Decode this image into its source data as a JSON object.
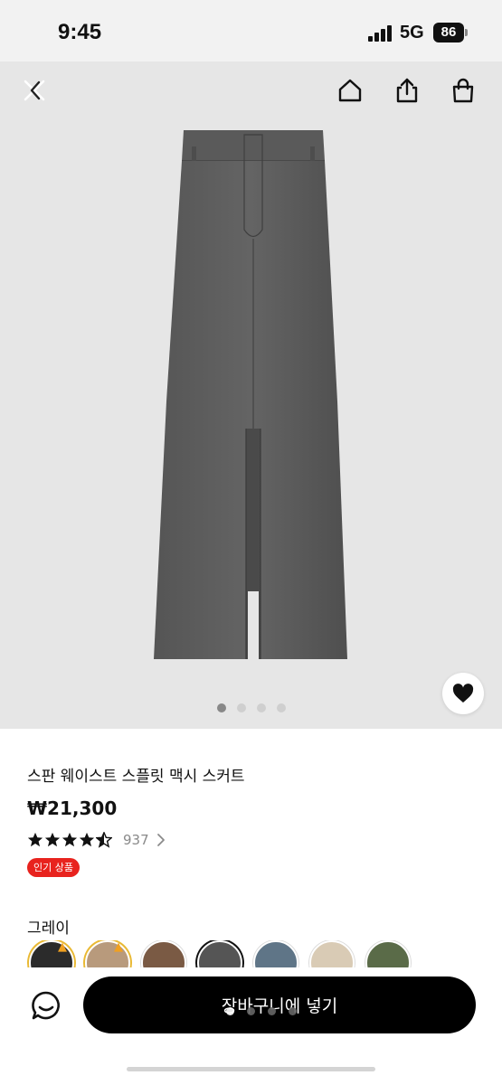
{
  "status_bar": {
    "time": "9:45",
    "network": "5G",
    "battery": "86"
  },
  "header": {
    "close_icon": "close-icon",
    "home_icon": "home-icon",
    "share_icon": "share-icon",
    "cart_icon": "shopping-bag-icon"
  },
  "gallery": {
    "image_count": 4,
    "active_index": 0,
    "wishlist_icon": "heart-icon"
  },
  "product": {
    "name": "스판 웨이스트 스플릿 맥시 스커트",
    "price": "₩21,300",
    "rating_value": 4.5,
    "review_count": "937",
    "badge": "인기 상품"
  },
  "colors": {
    "selected_name": "그레이",
    "swatches": [
      {
        "hex": "#2b2b2b",
        "hot": true
      },
      {
        "hex": "#b89a7c",
        "hot": true
      },
      {
        "hex": "#7a5a44",
        "hot": false
      },
      {
        "hex": "#555555",
        "hot": false,
        "selected": true
      },
      {
        "hex": "#5f7587",
        "hot": false
      },
      {
        "hex": "#d9cbb5",
        "hot": false
      },
      {
        "hex": "#5a6b48",
        "hot": false
      }
    ]
  },
  "footer": {
    "chat_icon": "chat-icon",
    "add_to_cart": "장바구니에 넣기"
  },
  "colors_theme": {
    "badge_red": "#e8231e",
    "button_black": "#000000",
    "skirt_gray": "#5c5c5c"
  }
}
